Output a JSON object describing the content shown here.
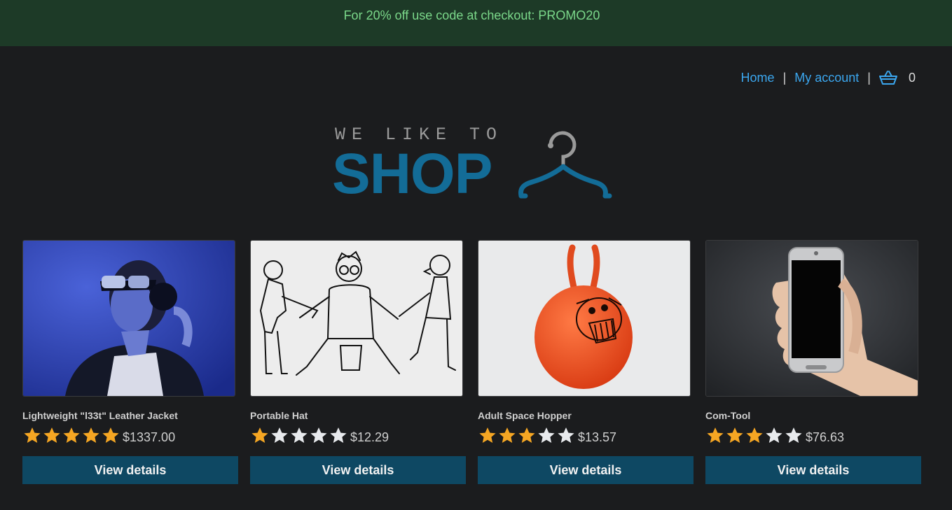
{
  "promo": {
    "text": "For 20% off use code at checkout: PROMO20"
  },
  "nav": {
    "home_label": "Home",
    "account_label": "My account",
    "separator": "|",
    "cart_count": "0",
    "cart_icon": "basket-icon"
  },
  "logo": {
    "tagline": "WE LIKE TO",
    "word": "SHOP",
    "icon": "clothes-hanger-icon"
  },
  "colors": {
    "background": "#1b1c1e",
    "promo_background": "#1d3a27",
    "promo_text": "#7bd88a",
    "link": "#3ba6ee",
    "logo_blue": "#136c97",
    "button": "#0e4863",
    "star_filled": "#f5a623",
    "star_empty": "#e8eaed"
  },
  "products": [
    {
      "name": "Lightweight \"l33t\" Leather Jacket",
      "rating": 5,
      "max_rating": 5,
      "price": "$1337.00",
      "button_label": "View details",
      "image": "woman-headphones-photo"
    },
    {
      "name": "Portable Hat",
      "rating": 1,
      "max_rating": 5,
      "price": "$12.29",
      "button_label": "View details",
      "image": "sketch-illustration"
    },
    {
      "name": "Adult Space Hopper",
      "rating": 3,
      "max_rating": 5,
      "price": "$13.57",
      "button_label": "View details",
      "image": "orange-space-hopper-photo"
    },
    {
      "name": "Com-Tool",
      "rating": 3,
      "max_rating": 5,
      "price": "$76.63",
      "button_label": "View details",
      "image": "hand-smartphone-photo"
    }
  ]
}
